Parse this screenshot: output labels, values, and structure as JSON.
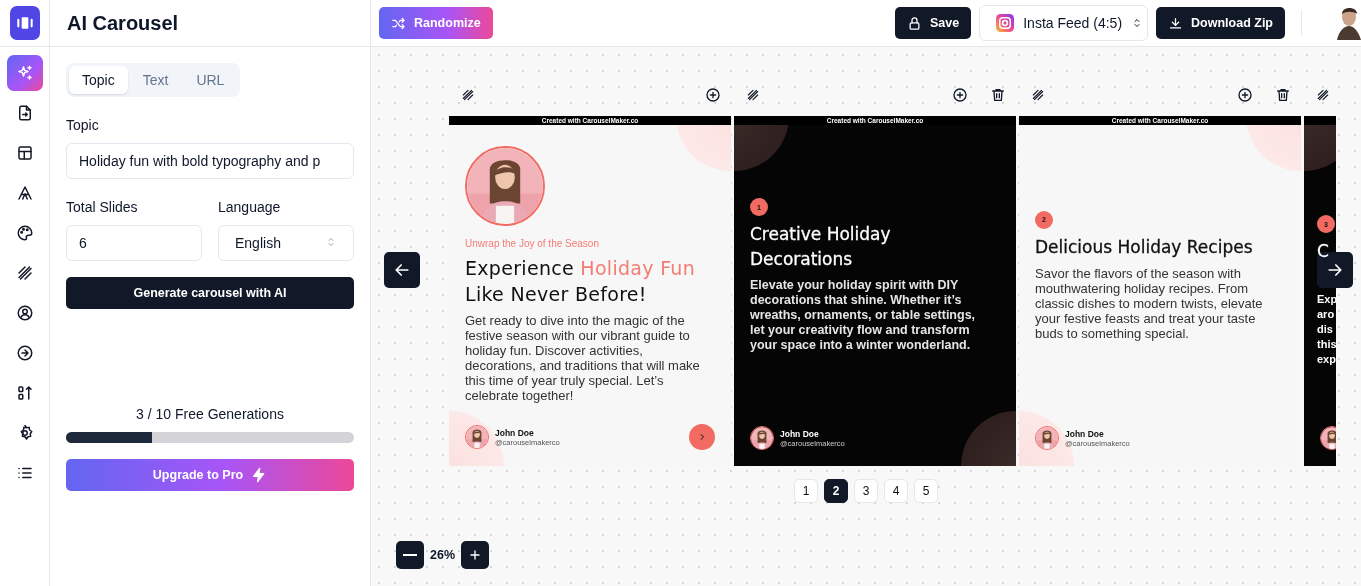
{
  "app": {
    "title": "AI Carousel"
  },
  "rail": [
    {
      "kind": "sparkles",
      "selected": true
    },
    {
      "kind": "file-import",
      "selected": false
    },
    {
      "kind": "layout",
      "selected": false
    },
    {
      "kind": "typeface",
      "selected": false
    },
    {
      "kind": "palette",
      "selected": false
    },
    {
      "kind": "pattern",
      "selected": false
    },
    {
      "kind": "user",
      "selected": false
    },
    {
      "kind": "arrow-circle",
      "selected": false
    },
    {
      "kind": "sort",
      "selected": false
    },
    {
      "kind": "settings",
      "selected": false
    },
    {
      "kind": "list",
      "selected": false
    }
  ],
  "panel": {
    "tabs": [
      {
        "label": "Topic",
        "selected": true
      },
      {
        "label": "Text",
        "selected": false
      },
      {
        "label": "URL",
        "selected": false
      }
    ],
    "topic": {
      "label": "Topic",
      "value": "Holiday fun with bold typography and p"
    },
    "total_slides": {
      "label": "Total Slides",
      "value": "6"
    },
    "language": {
      "label": "Language",
      "value": "English"
    },
    "generate_button": "Generate carousel with AI",
    "usage": {
      "text": "3 / 10 Free Generations",
      "level": 0.3
    },
    "upgrade_button": "Upgrade to Pro"
  },
  "toolbar": {
    "randomize": "Randomize",
    "save": "Save",
    "format": "Insta Feed (4:5)",
    "download": "Download Zip"
  },
  "slides": [
    {
      "kind": "intro",
      "dark": false,
      "deletable": false,
      "watermark": "Created with CarouselMaker.co",
      "kicker": "Unwrap the Joy of the Season",
      "title": [
        {
          "text": "Experience ",
          "accent": false
        },
        {
          "text": "Holiday Fun",
          "accent": true
        },
        {
          "text": " Like Never Before!",
          "accent": false
        }
      ],
      "body": "Get ready to dive into the magic of the festive season with our vibrant guide to holiday fun. Discover activities, decorations, and traditions that will make this time of year truly special. Let’s celebrate together!",
      "author": "John Doe",
      "handle": "@carouselmakerco"
    },
    {
      "kind": "content",
      "dark": true,
      "deletable": true,
      "watermark": "Created with CarouselMaker.co",
      "badge": "1",
      "title": "Creative Holiday Decorations",
      "body": "Elevate your holiday spirit with DIY decorations that shine. Whether it’s wreaths, ornaments, or table settings, let your creativity flow and transform your space into a winter wonderland.",
      "author": "John Doe",
      "handle": "@carouselmakerco"
    },
    {
      "kind": "content",
      "dark": false,
      "deletable": true,
      "watermark": "Created with CarouselMaker.co",
      "badge": "2",
      "title": "Delicious Holiday Recipes",
      "body": "Savor the flavors of the season with mouthwatering holiday recipes. From classic dishes to modern twists, elevate your festive feasts and treat your taste buds to something special.",
      "author": "John Doe",
      "handle": "@carouselmakerco"
    },
    {
      "kind": "partial",
      "dark": true,
      "badge": "3",
      "title": "C",
      "body_lines": [
        "Exp",
        "aro",
        "dis",
        "this",
        "exp"
      ]
    }
  ],
  "pagination": [
    {
      "label": "1",
      "selected": false
    },
    {
      "label": "2",
      "selected": true
    },
    {
      "label": "3",
      "selected": false
    },
    {
      "label": "4",
      "selected": false
    },
    {
      "label": "5",
      "selected": false
    }
  ],
  "zoom": "26%"
}
